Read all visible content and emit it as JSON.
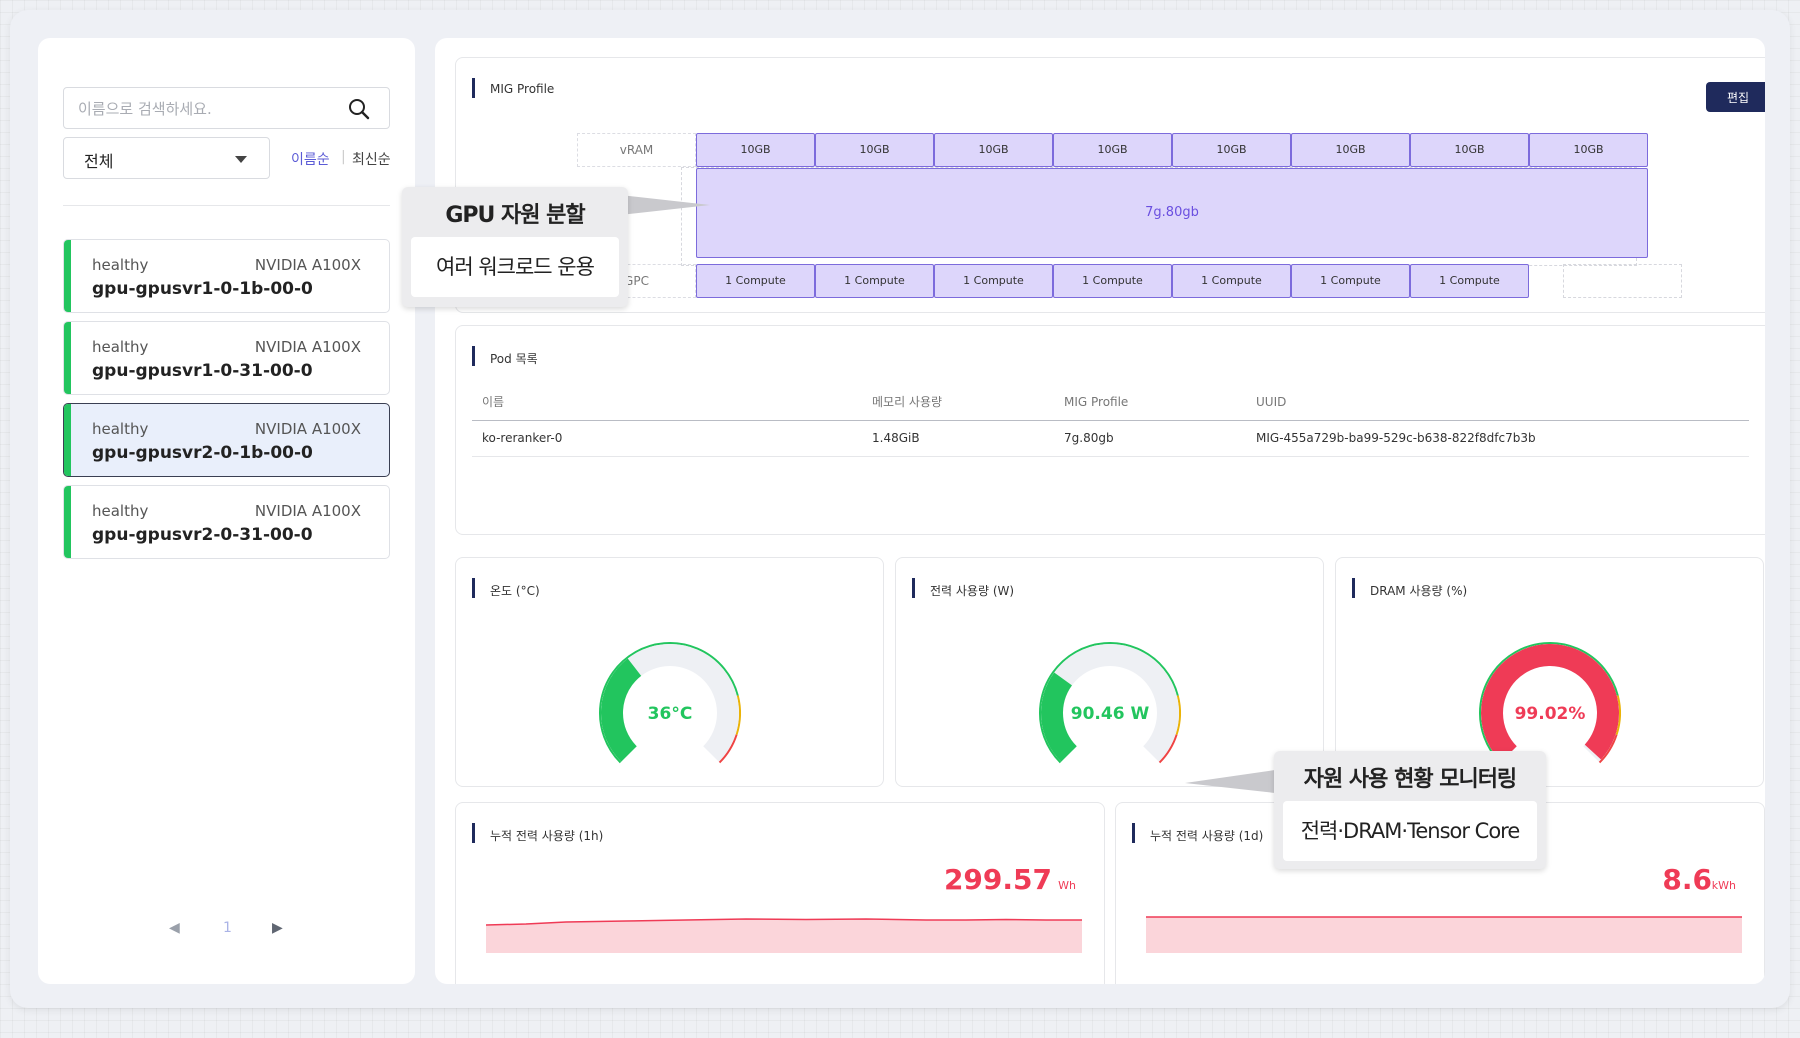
{
  "sidebar": {
    "search_placeholder": "이름으로 검색하세요.",
    "filter_value": "전체",
    "sort_name": "이름순",
    "sort_sep": "|",
    "sort_latest": "최신순",
    "gpus": [
      {
        "status": "healthy",
        "model": "NVIDIA A100X",
        "name": "gpu-gpusvr1-0-1b-00-0"
      },
      {
        "status": "healthy",
        "model": "NVIDIA A100X",
        "name": "gpu-gpusvr1-0-31-00-0"
      },
      {
        "status": "healthy",
        "model": "NVIDIA A100X",
        "name": "gpu-gpusvr2-0-1b-00-0"
      },
      {
        "status": "healthy",
        "model": "NVIDIA A100X",
        "name": "gpu-gpusvr2-0-31-00-0"
      }
    ],
    "pager": {
      "prev": "◀",
      "page": "1",
      "next": "▶"
    }
  },
  "mig": {
    "title": "MIG Profile",
    "edit_label": "편집",
    "vram_label": "vRAM",
    "gpc_label": "GPC",
    "vram_cells": [
      "10GB",
      "10GB",
      "10GB",
      "10GB",
      "10GB",
      "10GB",
      "10GB",
      "10GB"
    ],
    "instance": "7g.80gb",
    "compute_cells": [
      "1 Compute",
      "1 Compute",
      "1 Compute",
      "1 Compute",
      "1 Compute",
      "1 Compute",
      "1 Compute"
    ]
  },
  "pods": {
    "title": "Pod 목록",
    "headers": [
      "이름",
      "메모리 사용량",
      "MIG Profile",
      "UUID"
    ],
    "rows": [
      [
        "ko-reranker-0",
        "1.48GiB",
        "7g.80gb",
        "MIG-455a729b-ba99-529c-b638-822f8dfc7b3b"
      ]
    ]
  },
  "gauges": [
    {
      "title": "온도 (°C)",
      "value_text": "36°C",
      "fraction": 0.36,
      "color": "#22c55e"
    },
    {
      "title": "전력 사용량 (W)",
      "value_text": "90.46 W",
      "fraction": 0.3,
      "color": "#22c55e"
    },
    {
      "title": "DRAM 사용량 (%)",
      "value_text": "99.02%",
      "fraction": 0.99,
      "color": "#ef3b56"
    }
  ],
  "energy": [
    {
      "title": "누적 전력 사용량 (1h)",
      "value": "299.57",
      "unit": "Wh"
    },
    {
      "title": "누적 전력 사용량 (1d)",
      "value": "8.6",
      "unit": "kWh"
    }
  ],
  "callouts": {
    "gpu_split": {
      "head": "GPU 자원 분할",
      "body": "여러 워크로드 운용"
    },
    "monitoring": {
      "head": "자원 사용 현황 모니터링",
      "body": "전력·DRAM·Tensor Core"
    }
  },
  "colors": {
    "accent": "#1f2a5c",
    "healthy": "#22c55e",
    "alert": "#ef3b56",
    "mig_fill": "#ddd6fb"
  }
}
